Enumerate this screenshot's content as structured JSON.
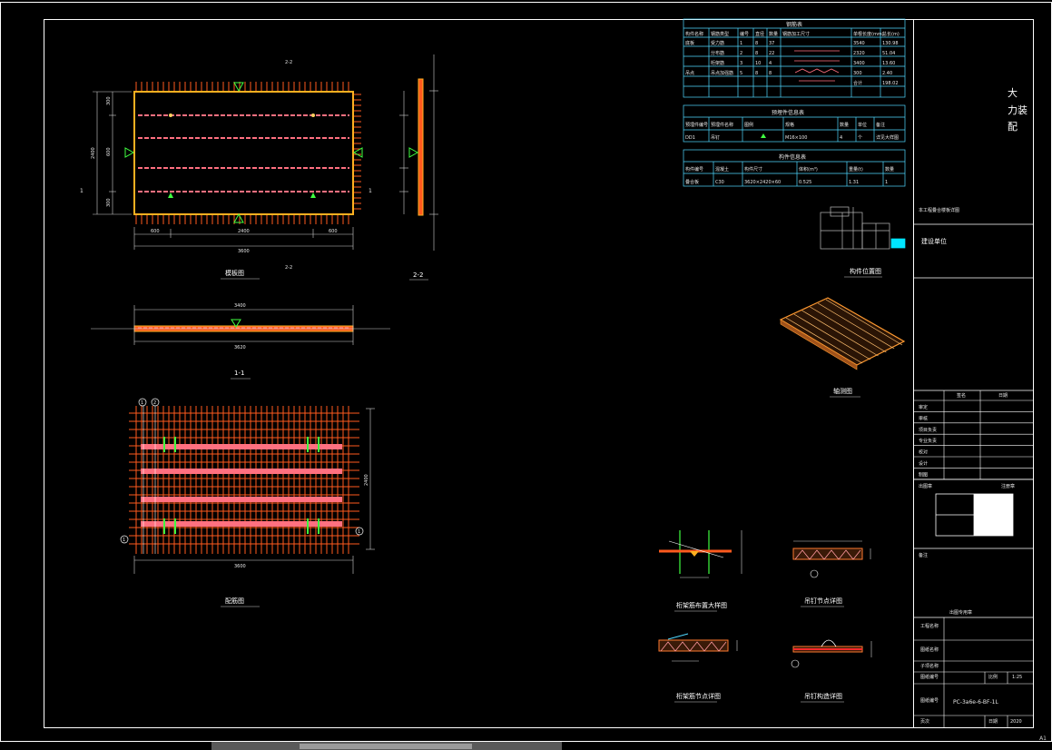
{
  "sheet": {
    "brand": "大\n力装\n配",
    "page_marker": "A1"
  },
  "views": {
    "plan": {
      "title": "模板图",
      "dims_h": [
        "600",
        "2400",
        "600"
      ],
      "total": "3600",
      "dims_v": [
        "300",
        "600",
        "300"
      ],
      "v_total": "2400",
      "tag": "2-2",
      "left": "1",
      "marker": "1"
    },
    "section22": {
      "title": "2-2"
    },
    "section11": {
      "title": "1-1",
      "top_total": "3400",
      "bot_total": "3620"
    },
    "rebar": {
      "title": "配筋图",
      "total": "3600",
      "v_total": "2400",
      "marks": [
        "1",
        "2"
      ]
    }
  },
  "tables": {
    "steel": {
      "title": "钢筋表",
      "headers": [
        "构件名称",
        "钢筋类型",
        "编号",
        "直径",
        "数量",
        "钢筋加工尺寸",
        "单根长度(mm)",
        "总长(m)"
      ],
      "rows": [
        [
          "底板",
          "受力筋",
          "1",
          "8",
          "37",
          "",
          "3540",
          "130.98"
        ],
        [
          "",
          "分布筋",
          "2",
          "8",
          "22",
          "",
          "2320",
          "51.04"
        ],
        [
          "",
          "桁架筋",
          "3",
          "10",
          "4",
          "",
          "3400",
          "13.60"
        ],
        [
          "吊点",
          "吊点加强筋",
          "5",
          "8",
          "8",
          "",
          "300",
          "2.40"
        ],
        [
          "",
          "",
          "",
          "",
          "",
          "",
          "合计",
          "198.02"
        ]
      ]
    },
    "embed": {
      "title": "预埋件信息表",
      "headers": [
        "预埋件编号",
        "预埋件名称",
        "图例",
        "规格",
        "数量",
        "单位",
        "备注"
      ],
      "rows": [
        [
          "DD1",
          "吊钉",
          "",
          "M16×100",
          "4",
          "个",
          "详见大样图"
        ]
      ]
    },
    "component": {
      "title": "构件信息表",
      "headers": [
        "构件编号",
        "混凝土",
        "构件尺寸",
        "体积(m³)",
        "重量(t)",
        "数量"
      ],
      "rows": [
        [
          "叠合板",
          "C30",
          "3620×2420×60",
          "0.525",
          "1.31",
          "1"
        ]
      ]
    }
  },
  "details": {
    "locator": "构件位置图",
    "axo": "轴测图",
    "d1": "桁架筋布置大样图",
    "d2": "吊钉节点详图",
    "d3": "桁架筋节点详图",
    "d4": "吊钉构造详图"
  },
  "titleblock": {
    "project_note": "本工程叠合楼板详图",
    "design_unit": "建设单位",
    "col_heads": [
      "签名",
      "日期"
    ],
    "roles": [
      "审定",
      "审核",
      "项目负责",
      "专业负责",
      "校对",
      "设计",
      "制图"
    ],
    "stamp_label": "出图章",
    "stamp_note": "注册章",
    "seal_label": "备注",
    "seal_note": "出图专用章",
    "project_name": "工程名称",
    "drawing_name": "图纸名称",
    "sub_item": "子项名称",
    "drawing_no_label": "图纸编号",
    "scale_label": "比例",
    "scale_value": "1:25",
    "drawing_code": "PC-3a6e-6-BF-1L",
    "page_label": "页次",
    "date_label": "日期",
    "date_value": "2020"
  }
}
